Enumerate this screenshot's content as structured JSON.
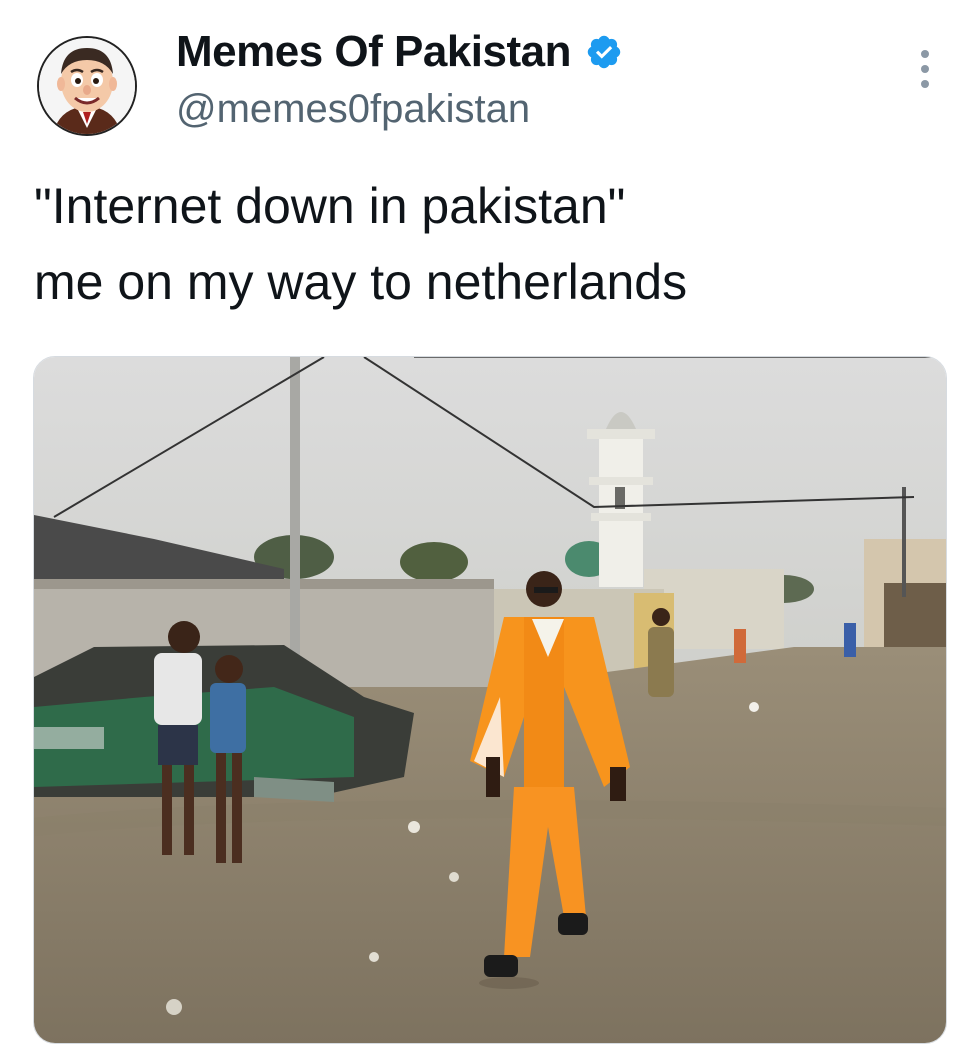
{
  "author": {
    "display_name": "Memes Of Pakistan",
    "handle": "@memes0fpakistan",
    "verified": true,
    "avatar_icon": "cartoon-face-avatar-icon",
    "verified_icon": "verified-badge-icon",
    "verified_color": "#1d9bf0"
  },
  "menu": {
    "icon": "more-options-icon"
  },
  "tweet": {
    "lines": [
      "\"Internet down in pakistan\"",
      "me on my way to netherlands"
    ]
  },
  "media": {
    "icon": "photo-media",
    "accent_color": "#f7941d"
  }
}
